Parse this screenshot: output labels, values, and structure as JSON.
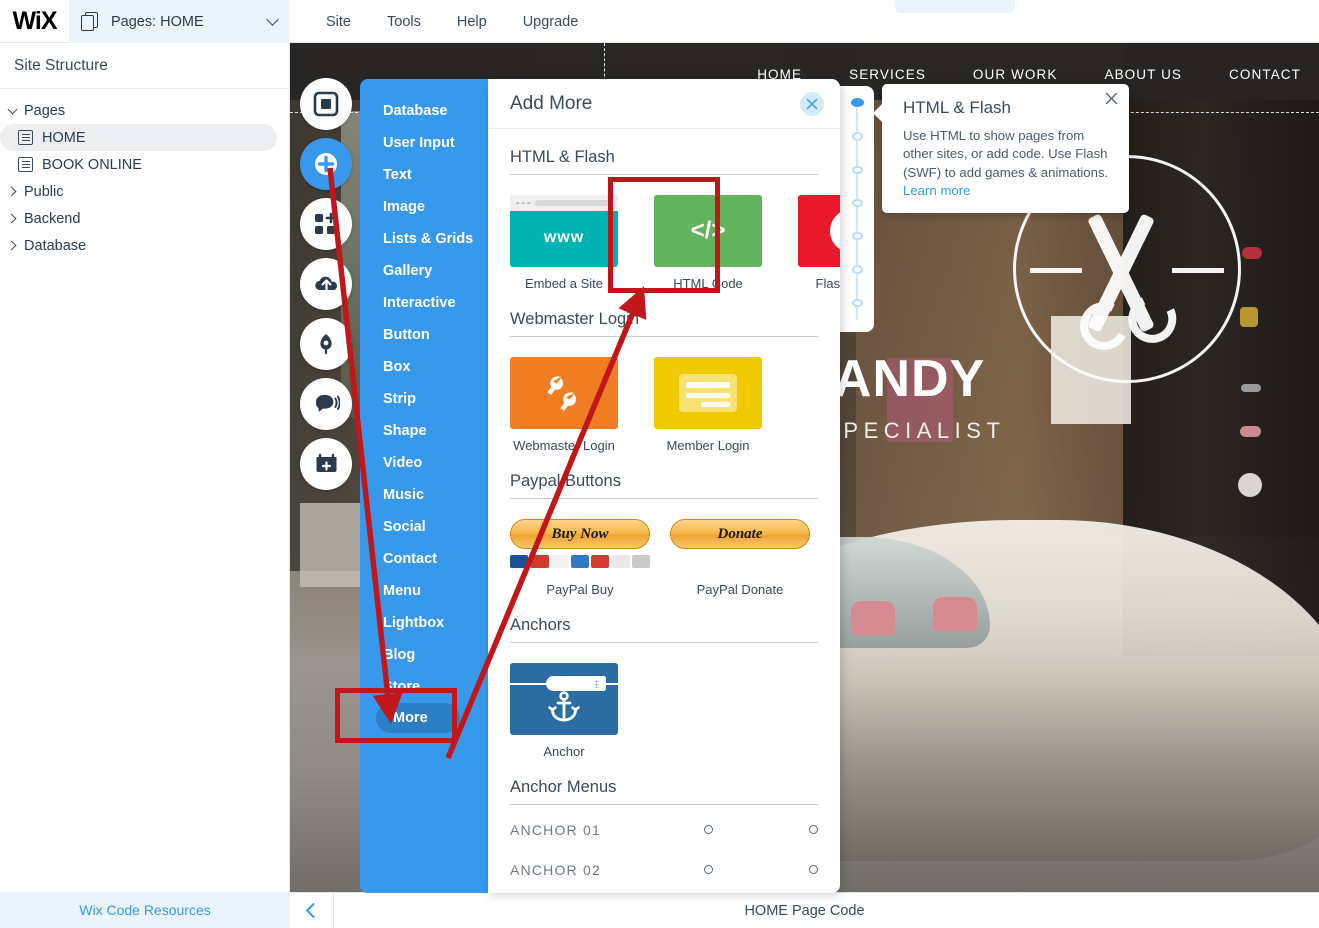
{
  "topbar": {
    "logo": "WiX",
    "pages_dropdown": {
      "label": "Pages: HOME",
      "icon": "pages-icon",
      "chevron": "chevron-down-icon"
    },
    "menu": [
      "Site",
      "Tools",
      "Help",
      "Upgrade"
    ]
  },
  "sidebar": {
    "title": "Site Structure",
    "tree": [
      {
        "label": "Pages",
        "level": 0,
        "expanded": true,
        "selected": false
      },
      {
        "label": "HOME",
        "level": 1,
        "expanded": null,
        "selected": true
      },
      {
        "label": "BOOK ONLINE",
        "level": 1,
        "expanded": null,
        "selected": false
      },
      {
        "label": "Public",
        "level": 0,
        "expanded": false,
        "selected": false
      },
      {
        "label": "Backend",
        "level": 0,
        "expanded": false,
        "selected": false
      },
      {
        "label": "Database",
        "level": 0,
        "expanded": false,
        "selected": false
      }
    ],
    "footer_link": "Wix Code Resources"
  },
  "icon_toolbar": [
    {
      "name": "menus-and-pages-icon",
      "active": false
    },
    {
      "name": "add-element-icon",
      "active": true
    },
    {
      "name": "add-apps-icon",
      "active": false
    },
    {
      "name": "my-uploads-icon",
      "active": false
    },
    {
      "name": "site-design-icon",
      "active": false
    },
    {
      "name": "add-blog-icon",
      "active": false
    },
    {
      "name": "add-bookings-icon",
      "active": false
    }
  ],
  "add_menu": {
    "items": [
      "Database",
      "User Input",
      "Text",
      "Image",
      "Lists & Grids",
      "Gallery",
      "Interactive",
      "Button",
      "Box",
      "Strip",
      "Shape",
      "Video",
      "Music",
      "Social",
      "Contact",
      "Menu",
      "Lightbox",
      "Blog",
      "Store"
    ],
    "selected": "More"
  },
  "panel": {
    "title": "Add More",
    "close_icon": "close-icon",
    "sections": [
      {
        "title": "HTML & Flash",
        "tiles": [
          {
            "caption": "Embed a Site",
            "art": "embed",
            "art_text": "www",
            "color": "#00b2b2"
          },
          {
            "caption": "HTML Code",
            "art": "code",
            "art_text": "</>",
            "color": "#63b25c",
            "highlighted": true
          },
          {
            "caption": "Flash (SWF)",
            "art": "flash",
            "art_text": "f",
            "color": "#e8192c"
          }
        ]
      },
      {
        "title": "Webmaster Login",
        "tiles": [
          {
            "caption": "Webmaster Login",
            "art": "webmaster",
            "color": "#f07d22"
          },
          {
            "caption": "Member Login",
            "art": "member",
            "color": "#f0ca00"
          }
        ]
      },
      {
        "title": "Paypal Buttons",
        "paypal": [
          {
            "button_label": "Buy Now",
            "caption": "PayPal Buy"
          },
          {
            "button_label": "Donate",
            "caption": "PayPal Donate"
          }
        ]
      },
      {
        "title": "Anchors",
        "tiles": [
          {
            "caption": "Anchor",
            "art": "anchor",
            "color": "#2b6ca3"
          }
        ]
      },
      {
        "title": "Anchor Menus",
        "anchor_rows": [
          "ANCHOR 01",
          "ANCHOR 02"
        ]
      }
    ]
  },
  "stepper": {
    "total": 7,
    "active_index": 0
  },
  "tooltip": {
    "title": "HTML & Flash",
    "body": "Use HTML to show pages from other sites, or add code. Use Flash (SWF) to add games & animations.",
    "link": "Learn more",
    "close_icon": "close-icon"
  },
  "canvas": {
    "site_menu": [
      "HOME",
      "SERVICES",
      "OUR WORK",
      "ABOUT US",
      "CONTACT"
    ],
    "hero_title": "JADE & ANDY",
    "hero_subtitle": "VINTAGE CAR SPECIALIST",
    "emblem": "crossed-wrenches-logo"
  },
  "bottombar": {
    "collapse_icon": "chevron-left-icon",
    "label": "HOME Page Code"
  },
  "colors": {
    "accent_blue": "#3899ec",
    "panel_blue": "#3899ec",
    "annotation_red": "#c1161a",
    "text_dark": "#3b4a5c"
  }
}
